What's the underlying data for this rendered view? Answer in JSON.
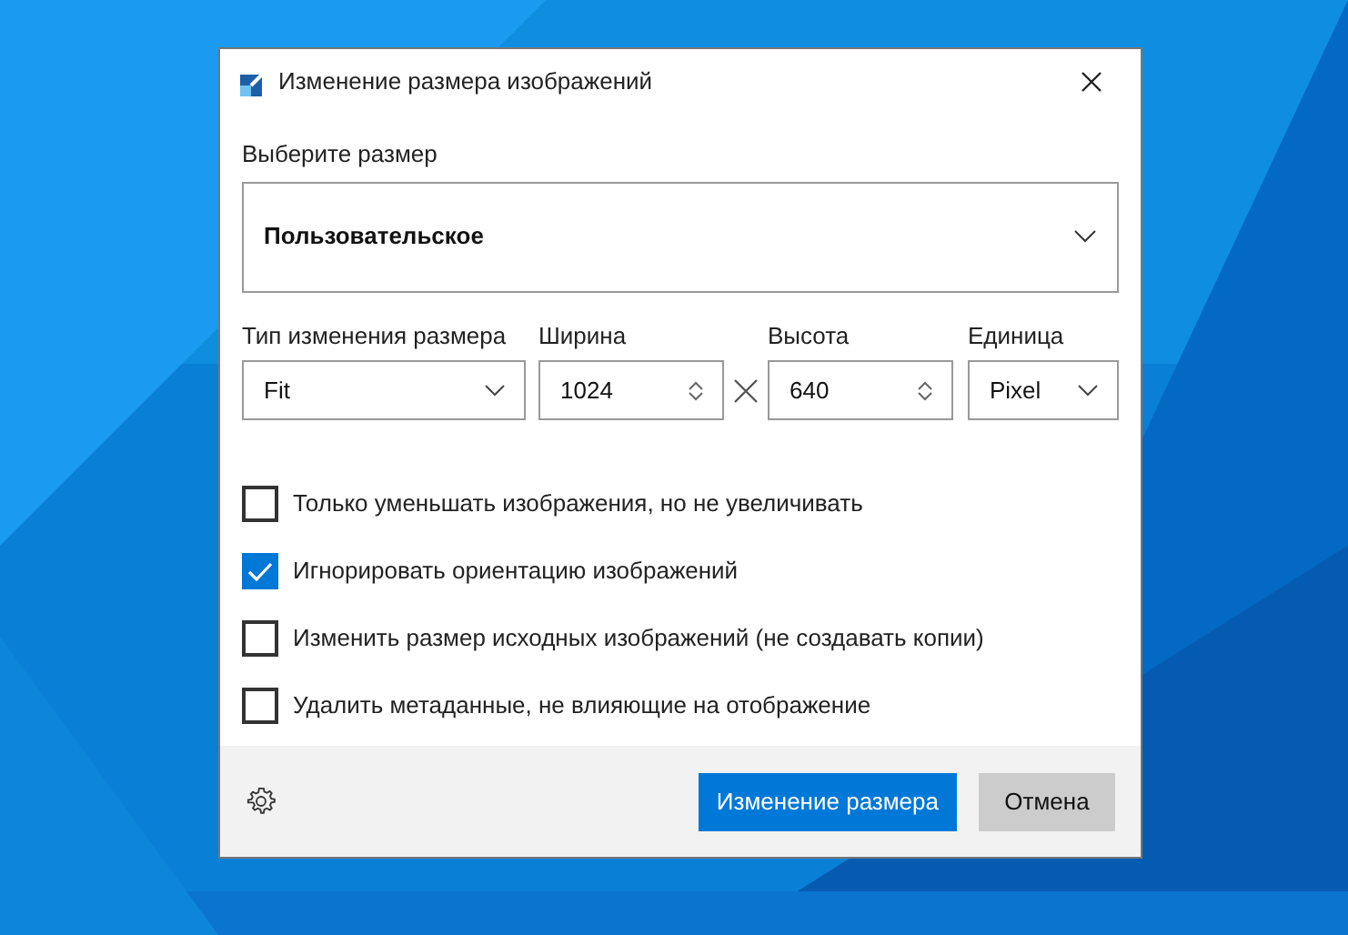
{
  "window": {
    "title": "Изменение размера изображений"
  },
  "size_label": "Выберите размер",
  "size_select": {
    "value": "Пользовательское"
  },
  "fields": [
    {
      "kind": "select",
      "label": "Тип изменения размера",
      "value": "Fit"
    },
    {
      "kind": "number",
      "label": "Ширина",
      "value": "1024"
    },
    {
      "kind": "number",
      "label": "Высота",
      "value": "640"
    },
    {
      "kind": "select",
      "label": "Единица",
      "value": "Pixel"
    }
  ],
  "options": [
    {
      "label": "Только уменьшать изображения, но не увеличивать",
      "checked": false
    },
    {
      "label": "Игнорировать ориентацию изображений",
      "checked": true
    },
    {
      "label": "Изменить размер исходных изображений (не создавать копии)",
      "checked": false
    },
    {
      "label": "Удалить метаданные, не влияющие на отображение",
      "checked": false
    }
  ],
  "buttons": [
    {
      "label": "Изменение размера",
      "kind": "primary"
    },
    {
      "label": "Отмена",
      "kind": "secondary"
    }
  ]
}
